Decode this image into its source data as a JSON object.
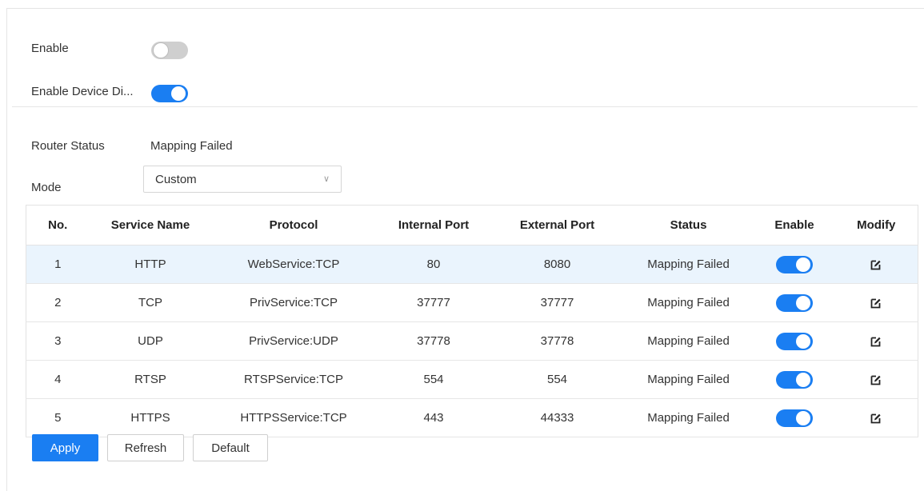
{
  "form": {
    "enable_label": "Enable",
    "enable_state": "off",
    "device_discovery_label": "Enable Device Di...",
    "device_discovery_state": "on",
    "router_status_label": "Router Status",
    "router_status_value": "Mapping Failed",
    "mode_label": "Mode",
    "mode_value": "Custom"
  },
  "table": {
    "headers": [
      "No.",
      "Service Name",
      "Protocol",
      "Internal Port",
      "External Port",
      "Status",
      "Enable",
      "Modify"
    ],
    "rows": [
      {
        "no": "1",
        "service": "HTTP",
        "protocol": "WebService:TCP",
        "internal": "80",
        "external": "8080",
        "status": "Mapping Failed",
        "enabled": "on",
        "selected": true
      },
      {
        "no": "2",
        "service": "TCP",
        "protocol": "PrivService:TCP",
        "internal": "37777",
        "external": "37777",
        "status": "Mapping Failed",
        "enabled": "on",
        "selected": false
      },
      {
        "no": "3",
        "service": "UDP",
        "protocol": "PrivService:UDP",
        "internal": "37778",
        "external": "37778",
        "status": "Mapping Failed",
        "enabled": "on",
        "selected": false
      },
      {
        "no": "4",
        "service": "RTSP",
        "protocol": "RTSPService:TCP",
        "internal": "554",
        "external": "554",
        "status": "Mapping Failed",
        "enabled": "on",
        "selected": false
      },
      {
        "no": "5",
        "service": "HTTPS",
        "protocol": "HTTPSService:TCP",
        "internal": "443",
        "external": "44333",
        "status": "Mapping Failed",
        "enabled": "on",
        "selected": false
      }
    ]
  },
  "buttons": {
    "apply": "Apply",
    "refresh": "Refresh",
    "default": "Default"
  },
  "colors": {
    "accent": "#1a7ef2",
    "selected_row": "#eaf4fd"
  },
  "icons": {
    "modify": "edit-icon",
    "mode_dropdown": "chevron-down-icon"
  }
}
